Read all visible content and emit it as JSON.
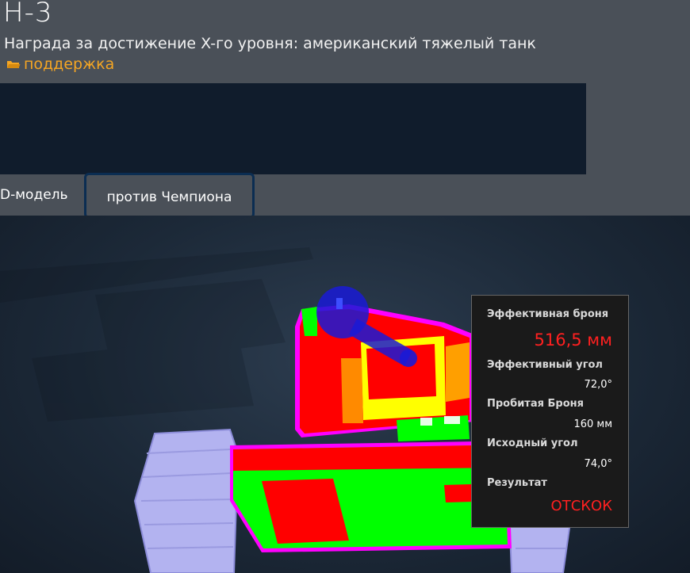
{
  "header": {
    "title": "Н-3",
    "subtitle": "Награда за достижение X-го уровня: американский тяжелый танк",
    "support_link": "поддержка",
    "support_icon": "folder-icon"
  },
  "tabs": [
    {
      "label": "D-модель",
      "active": false
    },
    {
      "label": "против Чемпиона",
      "active": true
    }
  ],
  "tooltip": {
    "effective_armor_label": "Эффективная броня",
    "effective_armor_value": "516,5 мм",
    "effective_angle_label": "Эффективный угол",
    "effective_angle_value": "72,0°",
    "penetration_label": "Пробитая Броня",
    "penetration_value": "160 мм",
    "initial_angle_label": "Исходный угол",
    "initial_angle_value": "74,0°",
    "result_label": "Результат",
    "result_value": "ОТСКОК"
  },
  "colors": {
    "accent_orange": "#f5a623",
    "result_red": "#ff2020",
    "armor_red": "#ff0000",
    "armor_green": "#00ff00",
    "armor_yellow": "#ffff00",
    "marker_blue": "#1a1ad6"
  }
}
